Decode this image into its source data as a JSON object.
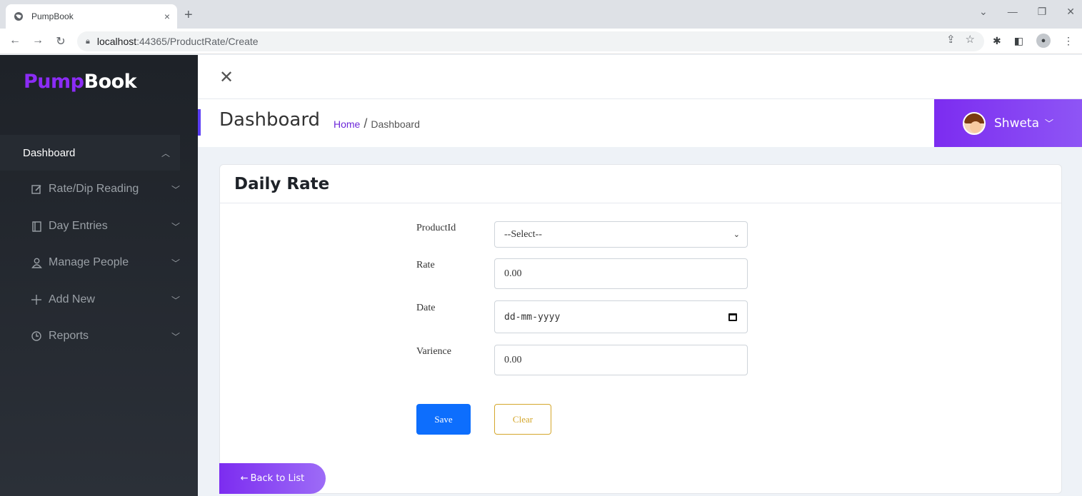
{
  "browser": {
    "tab_title": "PumpBook",
    "tab_close": "×",
    "new_tab": "+",
    "url_host": "localhost",
    "url_path": ":44365/ProductRate/Create"
  },
  "sidebar": {
    "brand_part1": "Pump",
    "brand_part2": "Book",
    "active_item": "Dashboard",
    "items": [
      {
        "label": "Rate/Dip Reading",
        "icon": "edit-icon"
      },
      {
        "label": "Day Entries",
        "icon": "book-icon"
      },
      {
        "label": "Manage People",
        "icon": "user-icon"
      },
      {
        "label": "Add New",
        "icon": "plus-icon"
      },
      {
        "label": "Reports",
        "icon": "clock-icon"
      }
    ]
  },
  "header": {
    "page_title": "Dashboard",
    "breadcrumb_home": "Home",
    "breadcrumb_sep": "/",
    "breadcrumb_current": "Dashboard",
    "user_name": "Shweta"
  },
  "card": {
    "title": "Daily Rate"
  },
  "form": {
    "product_label": "ProductId",
    "product_value": "--Select--",
    "rate_label": "Rate",
    "rate_value": "0.00",
    "date_label": "Date",
    "date_placeholder": "dd-mm-yyyy",
    "varience_label": "Varience",
    "varience_value": "0.00",
    "save_label": "Save",
    "clear_label": "Clear"
  },
  "back_label": "Back to List"
}
